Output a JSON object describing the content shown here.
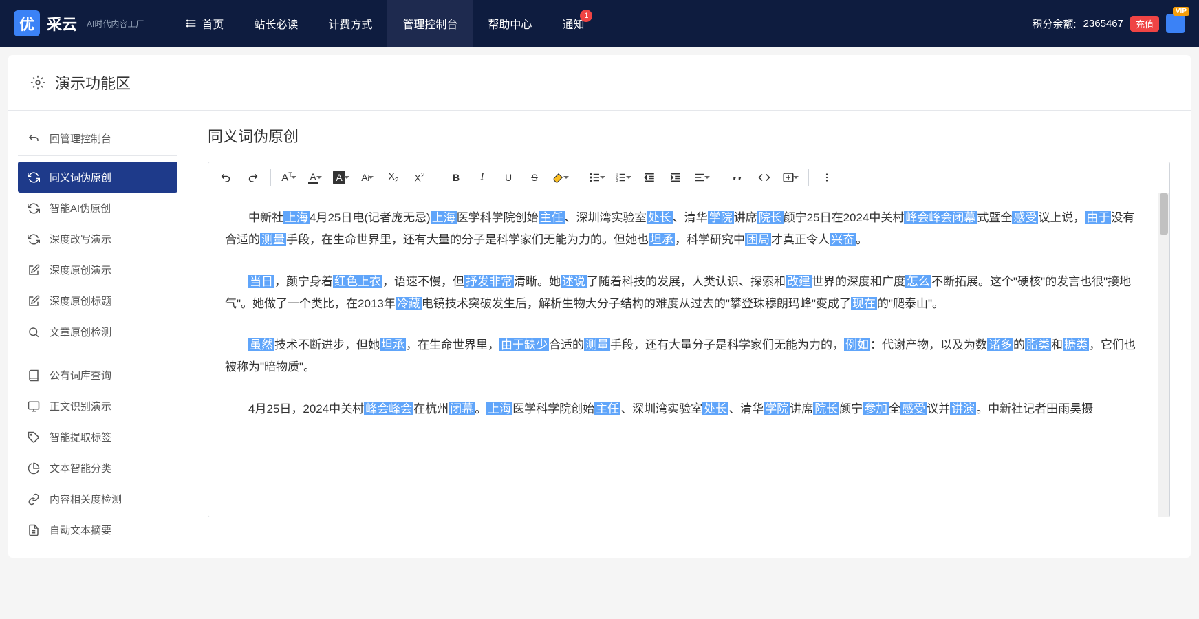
{
  "brand": {
    "logo_char": "优",
    "name": "采云",
    "slogan": "AI时代内容工厂"
  },
  "nav": {
    "home": "首页",
    "webmaster": "站长必读",
    "billing": "计费方式",
    "console": "管理控制台",
    "help": "帮助中心",
    "notice": "通知",
    "notice_count": "1"
  },
  "topright": {
    "points_label": "积分余额:",
    "points_value": "2365467",
    "recharge": "充值",
    "vip": "VIP"
  },
  "page": {
    "title": "演示功能区"
  },
  "sidebar": {
    "return": "回管理控制台",
    "synonym": "同义词伪原创",
    "ai": "智能AI伪原创",
    "deep_rewrite": "深度改写演示",
    "deep_original": "深度原创演示",
    "deep_title": "深度原创标题",
    "check": "文章原创检测",
    "dict": "公有词库查询",
    "body_rec": "正文识别演示",
    "tags": "智能提取标签",
    "classify": "文本智能分类",
    "relevance": "内容相关度检测",
    "summary": "自动文本摘要"
  },
  "main": {
    "title": "同义词伪原创"
  },
  "content": {
    "p1": {
      "t1": "中新社",
      "h1": "上海",
      "t2": "4月25日电(记者庞无忌)",
      "h2": "上海",
      "t3": "医学科学院创始",
      "h3": "主任",
      "t4": "、深圳湾实验室",
      "h4": "处长",
      "t5": "、清华",
      "h5": "学院",
      "t6": "讲席",
      "h6": "院长",
      "t7": "颜宁25日在2024中关村",
      "h7": "峰会峰会闭幕",
      "t8": "式暨全",
      "h8": "感受",
      "t9": "议上说，",
      "h9": "由于",
      "t10": "没有合适的",
      "h10": "测量",
      "t11": "手段，在生命世界里，还有大量的分子是科学家们无能为力的。但她也",
      "h11": "坦承",
      "t12": "，科学研究中",
      "h12": "困局",
      "t13": "才真正令人",
      "h13": "兴奋",
      "t14": "。"
    },
    "p2": {
      "h1": "当日",
      "t1": "，颜宁身着",
      "h2": "红色上衣",
      "t2": "，语速不慢，但",
      "h3": "抒发非常",
      "t3": "清晰。她",
      "h4": "述说",
      "t4": "了随着科技的发展，人类认识、探索和",
      "h5": "改建",
      "t5": "世界的深度和广度",
      "h6": "怎么",
      "t6": "不断拓展。这个\"硬核\"的发言也很\"接地气\"。她做了一个类比，在2013年",
      "h7": "冷藏",
      "t7": "电镜技术突破发生后，解析生物大分子结构的难度从过去的\"攀登珠穆朗玛峰\"变成了",
      "h8": "现在",
      "t8": "的\"爬泰山\"。"
    },
    "p3": {
      "h1": "虽然",
      "t1": "技术不断进步，但她",
      "h2": "坦承",
      "t2": "，在生命世界里，",
      "h3": "由于缺少",
      "t3": "合适的",
      "h4": "测量",
      "t4": "手段，还有大量分子是科学家们无能为力的，",
      "h5": "例如",
      "t5": "：代谢产物，以及为数",
      "h6": "诸多",
      "t6": "的",
      "h7": "脂类",
      "t7": "和",
      "h8": "糖类",
      "t8": "，它们也被称为\"暗物质\"。"
    },
    "p4": {
      "t1": "4月25日，2024中关村",
      "h1": "峰会峰会",
      "t2": "在杭州",
      "h2": "闭幕",
      "t3": "。",
      "h3": "上海",
      "t4": "医学科学院创始",
      "h4": "主任",
      "t5": "、深圳湾实验室",
      "h5": "处长",
      "t6": "、清华",
      "h6": "学院",
      "t7": "讲席",
      "h7": "院长",
      "t8": "颜宁",
      "h8": "参加",
      "t9": "全",
      "h9": "感受",
      "t10": "议并",
      "h10": "讲演",
      "t11": "。中新社记者田雨昊摄"
    }
  }
}
